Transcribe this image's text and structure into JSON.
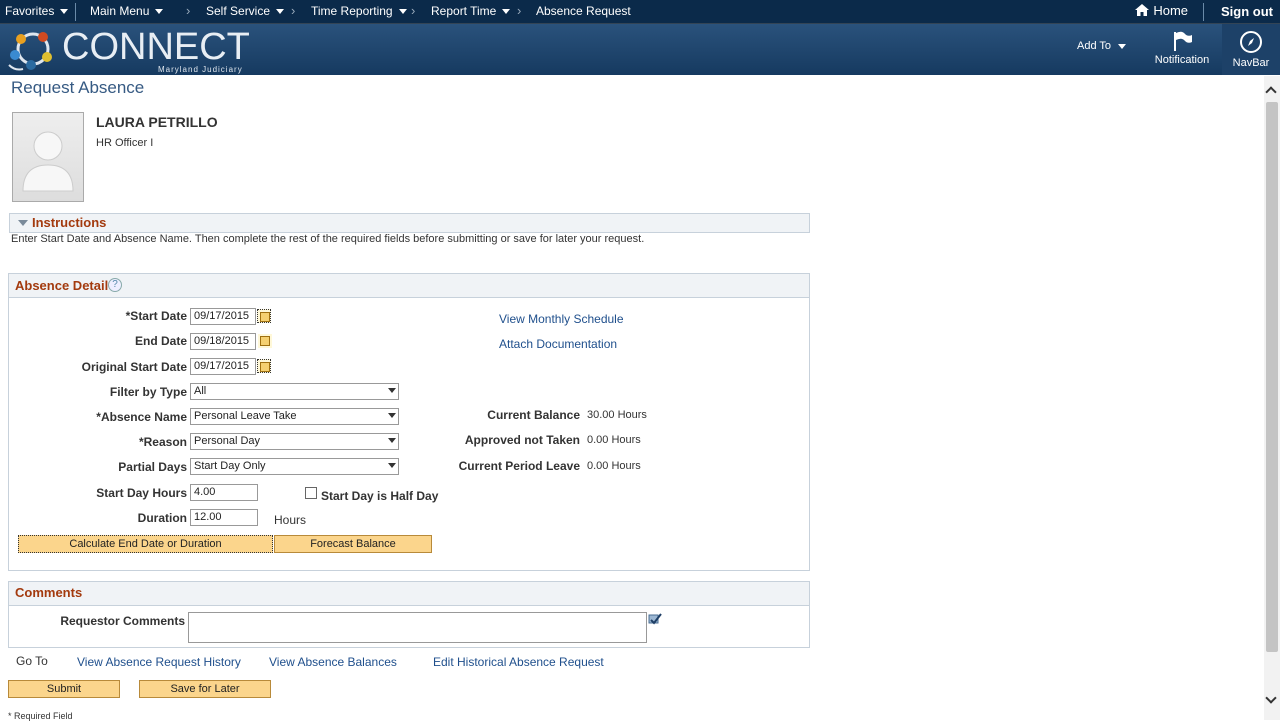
{
  "topnav": {
    "favorites": "Favorites",
    "main_menu": "Main Menu",
    "self_service": "Self Service",
    "time_reporting": "Time Reporting",
    "report_time": "Report Time",
    "absence_request": "Absence Request",
    "home": "Home",
    "sign_out": "Sign out"
  },
  "banner": {
    "logo": "CONNECT",
    "logo_sub": "Maryland Judiciary",
    "add_to": "Add To",
    "notification": "Notification",
    "navbar": "NavBar"
  },
  "page_title": "Request Absence",
  "employee": {
    "name": "LAURA PETRILLO",
    "title": "HR Officer I"
  },
  "instructions": {
    "header": "Instructions",
    "text": "Enter Start Date and Absence Name. Then complete the rest of the required fields before submitting or save for later your request."
  },
  "absence_detail": {
    "header": "Absence Detail",
    "help": "?",
    "start_date_label": "*Start Date",
    "start_date": "09/17/2015",
    "end_date_label": "End Date",
    "end_date": "09/18/2015",
    "orig_start_label": "Original Start Date",
    "orig_start": "09/17/2015",
    "filter_label": "Filter by Type",
    "filter": "All",
    "absence_name_label": "*Absence Name",
    "absence_name": "Personal Leave Take",
    "reason_label": "*Reason",
    "reason": "Personal Day",
    "partial_label": "Partial Days",
    "partial": "Start Day Only",
    "start_hours_label": "Start Day Hours",
    "start_hours": "4.00",
    "half_day_label": "Start Day is Half Day",
    "duration_label": "Duration",
    "duration": "12.00",
    "duration_unit": "Hours",
    "calc_button": "Calculate End Date or Duration",
    "forecast_button": "Forecast Balance",
    "view_schedule": "View Monthly Schedule",
    "attach_doc": "Attach Documentation",
    "current_balance_label": "Current Balance",
    "current_balance": "30.00 Hours",
    "approved_label": "Approved not Taken",
    "approved": "0.00 Hours",
    "current_period_label": "Current Period Leave",
    "current_period": "0.00 Hours"
  },
  "comments": {
    "header": "Comments",
    "requestor_label": "Requestor Comments",
    "requestor_value": ""
  },
  "goto": {
    "label": "Go To",
    "history": "View Absence Request History",
    "balances": "View Absence Balances",
    "edit_historical": "Edit Historical Absence Request"
  },
  "actions": {
    "submit": "Submit",
    "save_later": "Save for Later"
  },
  "footer": {
    "required": "* Required Field"
  }
}
